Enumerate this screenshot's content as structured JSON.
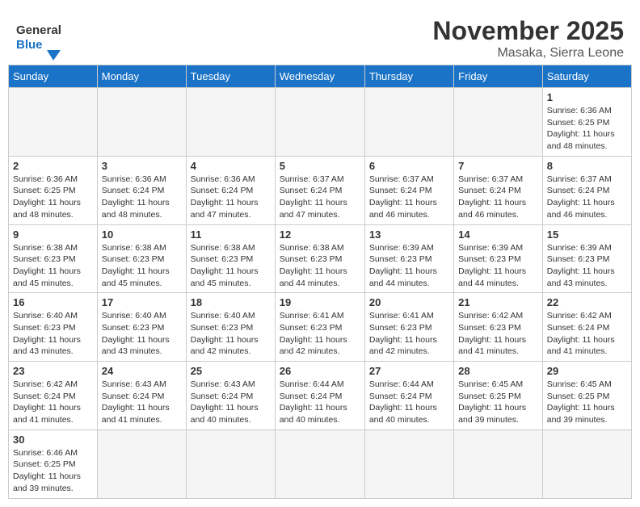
{
  "header": {
    "logo_general": "General",
    "logo_blue": "Blue",
    "title": "November 2025",
    "subtitle": "Masaka, Sierra Leone"
  },
  "days_of_week": [
    "Sunday",
    "Monday",
    "Tuesday",
    "Wednesday",
    "Thursday",
    "Friday",
    "Saturday"
  ],
  "weeks": [
    [
      {
        "day": "",
        "info": ""
      },
      {
        "day": "",
        "info": ""
      },
      {
        "day": "",
        "info": ""
      },
      {
        "day": "",
        "info": ""
      },
      {
        "day": "",
        "info": ""
      },
      {
        "day": "",
        "info": ""
      },
      {
        "day": "1",
        "info": "Sunrise: 6:36 AM\nSunset: 6:25 PM\nDaylight: 11 hours and 48 minutes."
      }
    ],
    [
      {
        "day": "2",
        "info": "Sunrise: 6:36 AM\nSunset: 6:25 PM\nDaylight: 11 hours and 48 minutes."
      },
      {
        "day": "3",
        "info": "Sunrise: 6:36 AM\nSunset: 6:24 PM\nDaylight: 11 hours and 48 minutes."
      },
      {
        "day": "4",
        "info": "Sunrise: 6:36 AM\nSunset: 6:24 PM\nDaylight: 11 hours and 47 minutes."
      },
      {
        "day": "5",
        "info": "Sunrise: 6:37 AM\nSunset: 6:24 PM\nDaylight: 11 hours and 47 minutes."
      },
      {
        "day": "6",
        "info": "Sunrise: 6:37 AM\nSunset: 6:24 PM\nDaylight: 11 hours and 46 minutes."
      },
      {
        "day": "7",
        "info": "Sunrise: 6:37 AM\nSunset: 6:24 PM\nDaylight: 11 hours and 46 minutes."
      },
      {
        "day": "8",
        "info": "Sunrise: 6:37 AM\nSunset: 6:24 PM\nDaylight: 11 hours and 46 minutes."
      }
    ],
    [
      {
        "day": "9",
        "info": "Sunrise: 6:38 AM\nSunset: 6:23 PM\nDaylight: 11 hours and 45 minutes."
      },
      {
        "day": "10",
        "info": "Sunrise: 6:38 AM\nSunset: 6:23 PM\nDaylight: 11 hours and 45 minutes."
      },
      {
        "day": "11",
        "info": "Sunrise: 6:38 AM\nSunset: 6:23 PM\nDaylight: 11 hours and 45 minutes."
      },
      {
        "day": "12",
        "info": "Sunrise: 6:38 AM\nSunset: 6:23 PM\nDaylight: 11 hours and 44 minutes."
      },
      {
        "day": "13",
        "info": "Sunrise: 6:39 AM\nSunset: 6:23 PM\nDaylight: 11 hours and 44 minutes."
      },
      {
        "day": "14",
        "info": "Sunrise: 6:39 AM\nSunset: 6:23 PM\nDaylight: 11 hours and 44 minutes."
      },
      {
        "day": "15",
        "info": "Sunrise: 6:39 AM\nSunset: 6:23 PM\nDaylight: 11 hours and 43 minutes."
      }
    ],
    [
      {
        "day": "16",
        "info": "Sunrise: 6:40 AM\nSunset: 6:23 PM\nDaylight: 11 hours and 43 minutes."
      },
      {
        "day": "17",
        "info": "Sunrise: 6:40 AM\nSunset: 6:23 PM\nDaylight: 11 hours and 43 minutes."
      },
      {
        "day": "18",
        "info": "Sunrise: 6:40 AM\nSunset: 6:23 PM\nDaylight: 11 hours and 42 minutes."
      },
      {
        "day": "19",
        "info": "Sunrise: 6:41 AM\nSunset: 6:23 PM\nDaylight: 11 hours and 42 minutes."
      },
      {
        "day": "20",
        "info": "Sunrise: 6:41 AM\nSunset: 6:23 PM\nDaylight: 11 hours and 42 minutes."
      },
      {
        "day": "21",
        "info": "Sunrise: 6:42 AM\nSunset: 6:23 PM\nDaylight: 11 hours and 41 minutes."
      },
      {
        "day": "22",
        "info": "Sunrise: 6:42 AM\nSunset: 6:24 PM\nDaylight: 11 hours and 41 minutes."
      }
    ],
    [
      {
        "day": "23",
        "info": "Sunrise: 6:42 AM\nSunset: 6:24 PM\nDaylight: 11 hours and 41 minutes."
      },
      {
        "day": "24",
        "info": "Sunrise: 6:43 AM\nSunset: 6:24 PM\nDaylight: 11 hours and 41 minutes."
      },
      {
        "day": "25",
        "info": "Sunrise: 6:43 AM\nSunset: 6:24 PM\nDaylight: 11 hours and 40 minutes."
      },
      {
        "day": "26",
        "info": "Sunrise: 6:44 AM\nSunset: 6:24 PM\nDaylight: 11 hours and 40 minutes."
      },
      {
        "day": "27",
        "info": "Sunrise: 6:44 AM\nSunset: 6:24 PM\nDaylight: 11 hours and 40 minutes."
      },
      {
        "day": "28",
        "info": "Sunrise: 6:45 AM\nSunset: 6:25 PM\nDaylight: 11 hours and 39 minutes."
      },
      {
        "day": "29",
        "info": "Sunrise: 6:45 AM\nSunset: 6:25 PM\nDaylight: 11 hours and 39 minutes."
      }
    ],
    [
      {
        "day": "30",
        "info": "Sunrise: 6:46 AM\nSunset: 6:25 PM\nDaylight: 11 hours and 39 minutes."
      },
      {
        "day": "",
        "info": ""
      },
      {
        "day": "",
        "info": ""
      },
      {
        "day": "",
        "info": ""
      },
      {
        "day": "",
        "info": ""
      },
      {
        "day": "",
        "info": ""
      },
      {
        "day": "",
        "info": ""
      }
    ]
  ]
}
